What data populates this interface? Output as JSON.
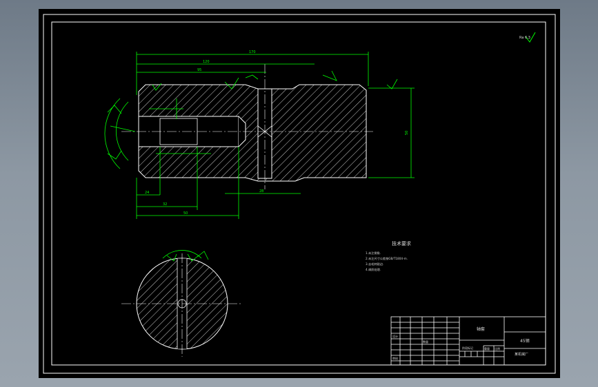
{
  "drawing": {
    "roughness_corner": "Ra 6.3",
    "technical_requirements": {
      "title": "技术要求",
      "items": [
        "1.未注倒角.",
        "2.未注尺寸公差按GB/T1804-m.",
        "3.去毛刺锐边.",
        "4.调质处理."
      ]
    },
    "dimensions": {
      "overall_length": "170",
      "length_a": "120",
      "length_b": "95",
      "depth_1": "24",
      "depth_2": "32",
      "depth_3": "50",
      "groove_width": "28",
      "height": "50"
    },
    "title_block": {
      "part_name": "轴套",
      "material": "45钢",
      "company": "某机械厂",
      "scale_label": "比例",
      "qty_label": "数量",
      "designer_label": "设计",
      "checker_label": "审核",
      "stage_label": "阶段标记",
      "weight_label": "重量"
    }
  },
  "colors": {
    "background": "#000000",
    "frame": "#ffffff",
    "geometry": "#ffffff",
    "dimension": "#00ff00",
    "centerline": "#ffffff",
    "viewport_outer": "#8b96a1"
  }
}
